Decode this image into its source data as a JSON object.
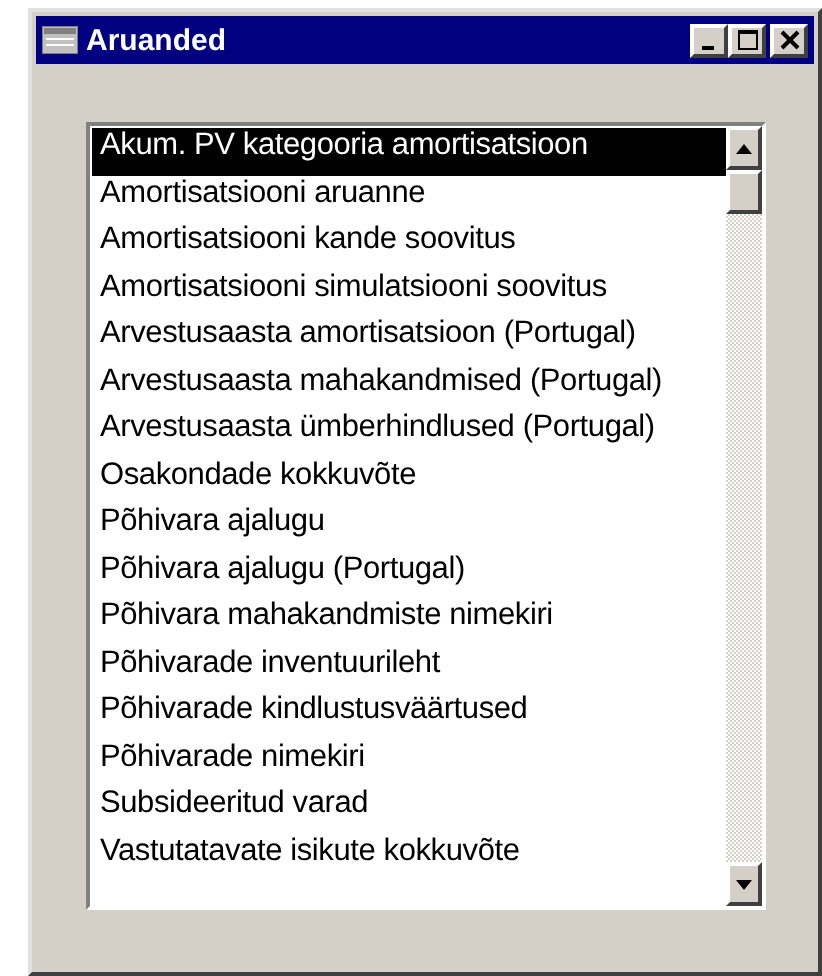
{
  "window": {
    "title": "Aruanded"
  },
  "list": {
    "items": [
      {
        "label": "Akum. PV kategooria amortisatsioon",
        "selected": true
      },
      {
        "label": "Amortisatsiooni aruanne",
        "selected": false
      },
      {
        "label": "Amortisatsiooni kande soovitus",
        "selected": false
      },
      {
        "label": "Amortisatsiooni simulatsiooni soovitus",
        "selected": false
      },
      {
        "label": "Arvestusaasta amortisatsioon (Portugal)",
        "selected": false
      },
      {
        "label": "Arvestusaasta mahakandmised (Portugal)",
        "selected": false
      },
      {
        "label": "Arvestusaasta ümberhindlused (Portugal)",
        "selected": false
      },
      {
        "label": "Osakondade kokkuvõte",
        "selected": false
      },
      {
        "label": "Põhivara ajalugu",
        "selected": false
      },
      {
        "label": "Põhivara ajalugu (Portugal)",
        "selected": false
      },
      {
        "label": "Põhivara mahakandmiste nimekiri",
        "selected": false
      },
      {
        "label": "Põhivarade inventuurileht",
        "selected": false
      },
      {
        "label": "Põhivarade kindlustusväärtused",
        "selected": false
      },
      {
        "label": "Põhivarade nimekiri",
        "selected": false
      },
      {
        "label": "Subsideeritud varad",
        "selected": false
      },
      {
        "label": "Vastutatavate isikute kokkuvõte",
        "selected": false
      }
    ]
  }
}
